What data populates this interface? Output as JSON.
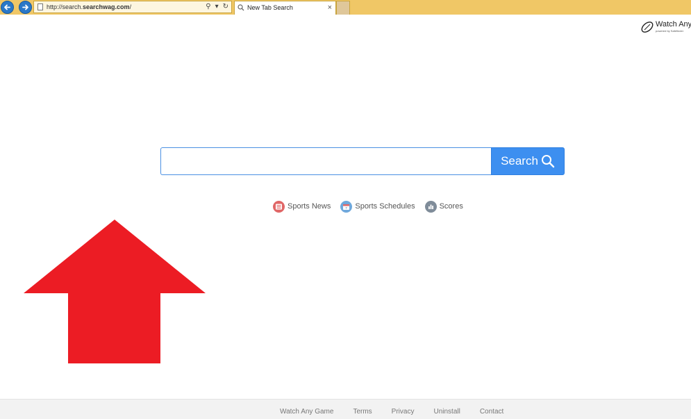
{
  "browser": {
    "url_prefix": "http://search.",
    "url_domain": "searchwag.com",
    "url_suffix": "/",
    "tab_title": "New Tab Search",
    "tab_close": "×",
    "address_tools": [
      "⚲",
      "▾",
      "↻"
    ]
  },
  "logo": {
    "text": "Watch Any",
    "subtext": "powered by Safefinder"
  },
  "search": {
    "placeholder": "",
    "value": "",
    "button_label": "Search"
  },
  "quick_links": [
    {
      "label": "Sports News",
      "icon": "newspaper-icon",
      "color": "#e06666"
    },
    {
      "label": "Sports Schedules",
      "icon": "calendar-icon",
      "color": "#6fa8dc"
    },
    {
      "label": "Scores",
      "icon": "bar-chart-icon",
      "color": "#7f8c99"
    }
  ],
  "annotation": {
    "arrow_color": "#ec1c24"
  },
  "footer": {
    "links": [
      "Watch Any Game",
      "Terms",
      "Privacy",
      "Uninstall",
      "Contact"
    ]
  },
  "colors": {
    "chrome": "#f0c766",
    "accent": "#3d8ff0"
  }
}
